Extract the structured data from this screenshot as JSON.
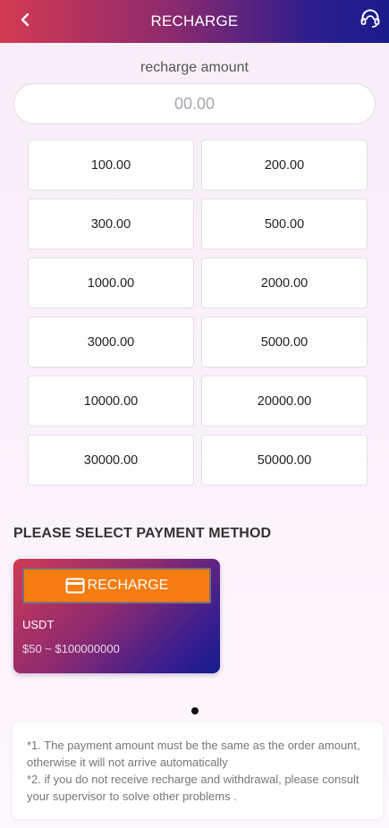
{
  "header": {
    "title": "RECHARGE",
    "back_icon": "chevron-left-icon",
    "support_icon": "headset-icon"
  },
  "amount": {
    "label": "recharge amount",
    "placeholder": "00.00",
    "value": ""
  },
  "presets": [
    "100.00",
    "200.00",
    "300.00",
    "500.00",
    "1000.00",
    "2000.00",
    "3000.00",
    "5000.00",
    "10000.00",
    "20000.00",
    "30000.00",
    "50000.00"
  ],
  "payment": {
    "title": "PLEASE SELECT PAYMENT METHOD",
    "card": {
      "button_label": "RECHARGE",
      "button_icon": "credit-card-icon",
      "name": "USDT",
      "range": "$50 ~ $100000000"
    }
  },
  "notes": {
    "line1": "*1. The payment amount must be the same as the order amount, otherwise it will not arrive automatically",
    "line2": "*2. if you do not receive recharge and withdrawal, please consult your supervisor to solve other problems ."
  },
  "colors": {
    "header_gradient_start": "#d43a52",
    "header_gradient_end": "#1a1b8c",
    "recharge_button": "#f57c10"
  }
}
